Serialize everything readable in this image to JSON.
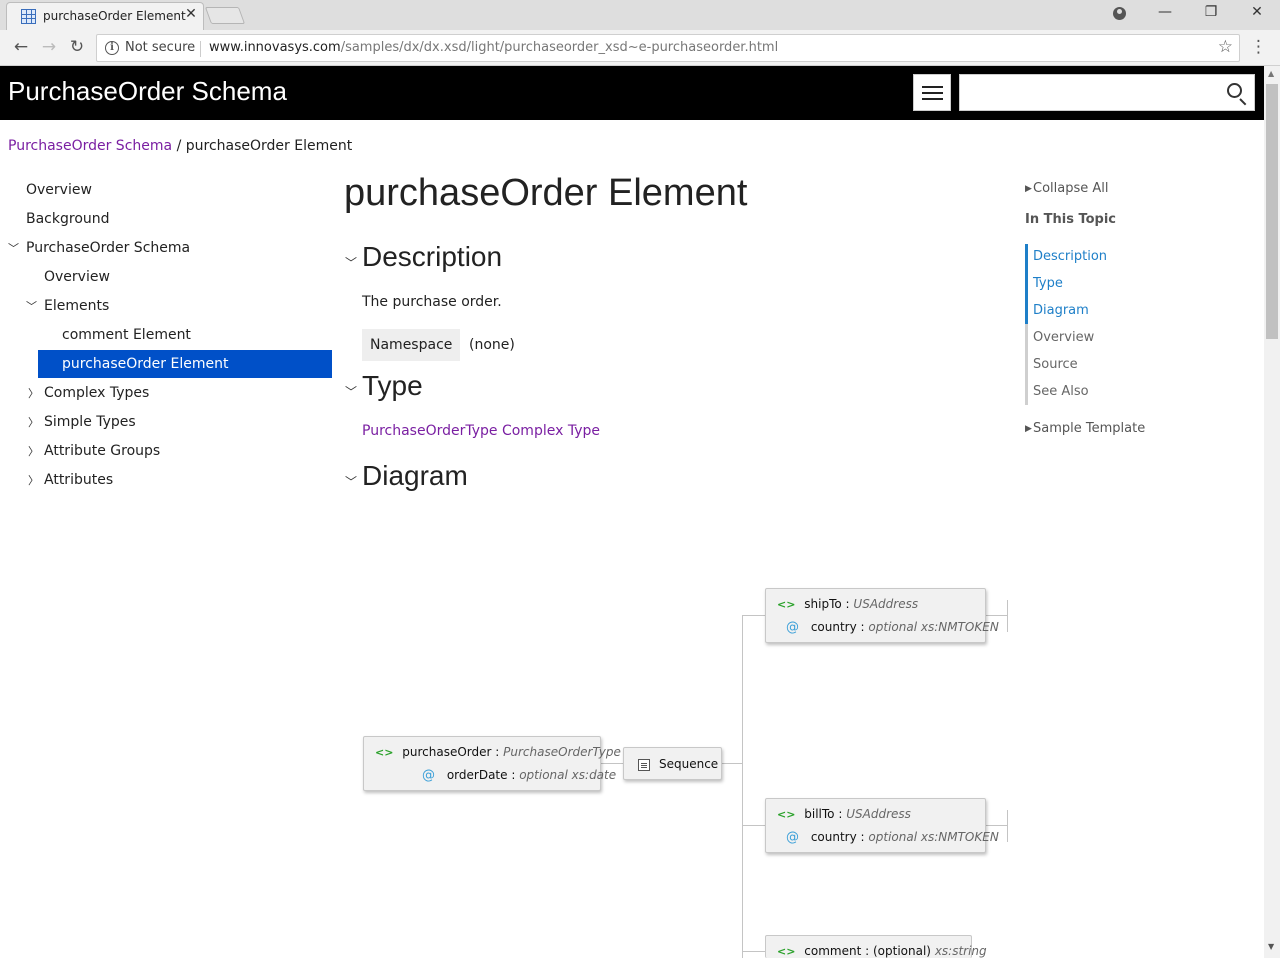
{
  "browser": {
    "tab_title": "purchaseOrder Element",
    "security_label": "Not secure",
    "url_host": "www.innovasys.com",
    "url_path": "/samples/dx/dx.xsd/light/purchaseorder_xsd~e-purchaseorder.html"
  },
  "header": {
    "site_title": "PurchaseOrder Schema",
    "search_placeholder": ""
  },
  "breadcrumb": {
    "parent": "PurchaseOrder Schema",
    "separator": "/",
    "current": "purchaseOrder Element"
  },
  "nav": {
    "items": [
      {
        "label": "Overview"
      },
      {
        "label": "Background"
      },
      {
        "label": "PurchaseOrder Schema"
      },
      {
        "label": "Overview"
      },
      {
        "label": "Elements"
      },
      {
        "label": "comment Element"
      },
      {
        "label": "purchaseOrder Element"
      },
      {
        "label": "Complex Types"
      },
      {
        "label": "Simple Types"
      },
      {
        "label": "Attribute Groups"
      },
      {
        "label": "Attributes"
      }
    ]
  },
  "main": {
    "title": "purchaseOrder Element",
    "description_heading": "Description",
    "description_text": "The purchase order.",
    "namespace_label": "Namespace",
    "namespace_value": "(none)",
    "type_heading": "Type",
    "type_link": "PurchaseOrderType Complex Type",
    "diagram_heading": "Diagram"
  },
  "right_toc": {
    "collapse_all": "Collapse All",
    "in_this_topic": "In This Topic",
    "links": [
      "Description",
      "Type",
      "Diagram",
      "Overview",
      "Source",
      "See Also"
    ],
    "sample_template": "Sample Template",
    "active_color": "#1e7fc8",
    "inactive_color": "#666666"
  },
  "diagram": {
    "root": {
      "name": "purchaseOrder",
      "type": "PurchaseOrderType",
      "attr_name": "orderDate",
      "attr_type": "optional xs:date"
    },
    "sequence_label": "Sequence",
    "shipTo": {
      "name": "shipTo",
      "type": "USAddress",
      "attr_name": "country",
      "attr_type": "optional xs:NMTOKEN"
    },
    "billTo": {
      "name": "billTo",
      "type": "USAddress",
      "attr_name": "country",
      "attr_type": "optional xs:NMTOKEN"
    },
    "comment": {
      "name": "comment",
      "qualifier": "(optional)",
      "type": "xs:string"
    },
    "colon": ":",
    "element_icon": "<>",
    "attribute_icon": "@"
  }
}
